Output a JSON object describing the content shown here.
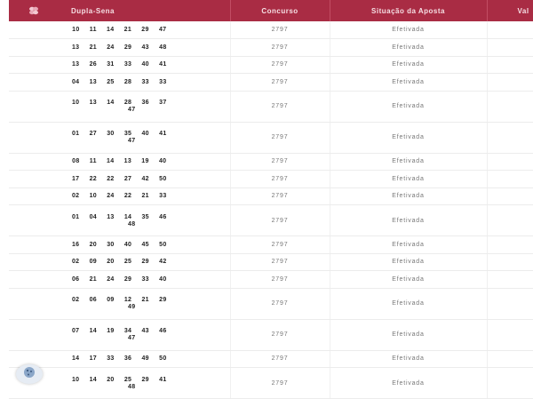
{
  "table": {
    "headers": [
      "Dupla-Sena",
      "Concurso",
      "Situação da Aposta",
      "Val"
    ],
    "rows": [
      {
        "numbers": "10 11 14 21 29 47",
        "extra": "",
        "concurso": "2797",
        "status": "Efetivada"
      },
      {
        "numbers": "13 21 24 29 43 48",
        "extra": "",
        "concurso": "2797",
        "status": "Efetivada"
      },
      {
        "numbers": "13 26 31 33 40 41",
        "extra": "",
        "concurso": "2797",
        "status": "Efetivada"
      },
      {
        "numbers": "04 13 25 28 33 33",
        "extra": "",
        "concurso": "2797",
        "status": "Efetivada"
      },
      {
        "numbers": "10 13 14 28 36 37",
        "extra": "47",
        "concurso": "2797",
        "status": "Efetivada"
      },
      {
        "numbers": "01 27 30 35 40 41",
        "extra": "47",
        "concurso": "2797",
        "status": "Efetivada"
      },
      {
        "numbers": "08 11 14 13 19 40",
        "extra": "",
        "concurso": "2797",
        "status": "Efetivada"
      },
      {
        "numbers": "17 22 22 27 42 50",
        "extra": "",
        "concurso": "2797",
        "status": "Efetivada"
      },
      {
        "numbers": "02 10 24 22 21 33",
        "extra": "",
        "concurso": "2797",
        "status": "Efetivada"
      },
      {
        "numbers": "01 04 13 14 35 46",
        "extra": "48",
        "concurso": "2797",
        "status": "Efetivada"
      },
      {
        "numbers": "16 20 30 40 45 50",
        "extra": "",
        "concurso": "2797",
        "status": "Efetivada"
      },
      {
        "numbers": "02 09 20 25 29 42",
        "extra": "",
        "concurso": "2797",
        "status": "Efetivada"
      },
      {
        "numbers": "06 21 24 29 33 40",
        "extra": "",
        "concurso": "2797",
        "status": "Efetivada"
      },
      {
        "numbers": "02 06 09 12 21 29",
        "extra": "49",
        "concurso": "2797",
        "status": "Efetivada"
      },
      {
        "numbers": "07 14 19 34 43 46",
        "extra": "47",
        "concurso": "2797",
        "status": "Efetivada"
      },
      {
        "numbers": "14 17 33 36 49 50",
        "extra": "",
        "concurso": "2797",
        "status": "Efetivada"
      },
      {
        "numbers": "10 14 20 25 29 41",
        "extra": "48",
        "concurso": "2797",
        "status": "Efetivada"
      }
    ]
  },
  "icons": {
    "logo": "clover-logo-icon",
    "cookie": "cookie-icon"
  },
  "colors": {
    "header_bg": "#a92c44"
  }
}
